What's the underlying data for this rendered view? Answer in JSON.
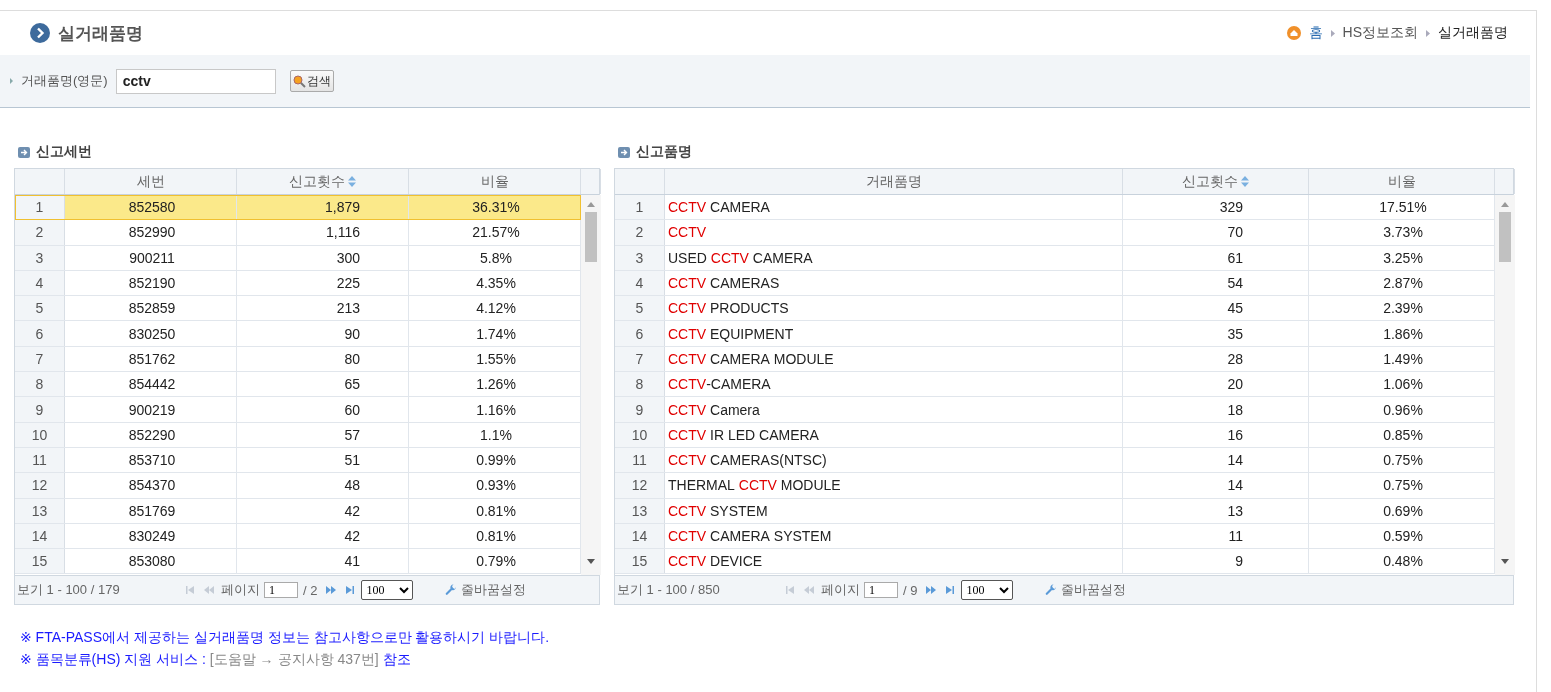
{
  "header": {
    "title": "실거래품명",
    "breadcrumb": [
      {
        "label": "홈",
        "kind": "home"
      },
      {
        "label": "HS정보조회",
        "kind": "link"
      },
      {
        "label": "실거래품명",
        "kind": "current"
      }
    ]
  },
  "search": {
    "label": "거래품명(영문)",
    "value": "cctv",
    "button": "검색"
  },
  "panels": [
    {
      "title": "신고세번",
      "columns": [
        {
          "label": "세번",
          "sortable": false
        },
        {
          "label": "신고횟수",
          "sortable": true
        },
        {
          "label": "비율",
          "sortable": false
        }
      ],
      "rows": [
        {
          "no": "1",
          "selected": true,
          "cells": [
            "852580",
            "1,879",
            "36.31%"
          ]
        },
        {
          "no": "2",
          "selected": false,
          "cells": [
            "852990",
            "1,116",
            "21.57%"
          ]
        },
        {
          "no": "3",
          "selected": false,
          "cells": [
            "900211",
            "300",
            "5.8%"
          ]
        },
        {
          "no": "4",
          "selected": false,
          "cells": [
            "852190",
            "225",
            "4.35%"
          ]
        },
        {
          "no": "5",
          "selected": false,
          "cells": [
            "852859",
            "213",
            "4.12%"
          ]
        },
        {
          "no": "6",
          "selected": false,
          "cells": [
            "830250",
            "90",
            "1.74%"
          ]
        },
        {
          "no": "7",
          "selected": false,
          "cells": [
            "851762",
            "80",
            "1.55%"
          ]
        },
        {
          "no": "8",
          "selected": false,
          "cells": [
            "854442",
            "65",
            "1.26%"
          ]
        },
        {
          "no": "9",
          "selected": false,
          "cells": [
            "900219",
            "60",
            "1.16%"
          ]
        },
        {
          "no": "10",
          "selected": false,
          "cells": [
            "852290",
            "57",
            "1.1%"
          ]
        },
        {
          "no": "11",
          "selected": false,
          "cells": [
            "853710",
            "51",
            "0.99%"
          ]
        },
        {
          "no": "12",
          "selected": false,
          "cells": [
            "854370",
            "48",
            "0.93%"
          ]
        },
        {
          "no": "13",
          "selected": false,
          "cells": [
            "851769",
            "42",
            "0.81%"
          ]
        },
        {
          "no": "14",
          "selected": false,
          "cells": [
            "830249",
            "42",
            "0.81%"
          ]
        },
        {
          "no": "15",
          "selected": false,
          "cells": [
            "853080",
            "41",
            "0.79%"
          ]
        }
      ],
      "footer": {
        "range": "보기 1 - 100 / 179",
        "page_label": "페이지",
        "page": "1",
        "page_total": "/ 2",
        "page_size": "100",
        "wrap": "줄바꿈설정"
      }
    },
    {
      "title": "신고품명",
      "columns": [
        {
          "label": "거래품명",
          "sortable": false
        },
        {
          "label": "신고횟수",
          "sortable": true
        },
        {
          "label": "비율",
          "sortable": false
        }
      ],
      "rows": [
        {
          "no": "1",
          "selected": false,
          "cells": [
            {
              "parts": [
                {
                  "text": "CCTV",
                  "match": true
                },
                {
                  "text": " CAMERA",
                  "match": false
                }
              ]
            },
            "329",
            "17.51%"
          ]
        },
        {
          "no": "2",
          "selected": false,
          "cells": [
            {
              "parts": [
                {
                  "text": "CCTV",
                  "match": true
                }
              ]
            },
            "70",
            "3.73%"
          ]
        },
        {
          "no": "3",
          "selected": false,
          "cells": [
            {
              "parts": [
                {
                  "text": "USED ",
                  "match": false
                },
                {
                  "text": "CCTV",
                  "match": true
                },
                {
                  "text": " CAMERA",
                  "match": false
                }
              ]
            },
            "61",
            "3.25%"
          ]
        },
        {
          "no": "4",
          "selected": false,
          "cells": [
            {
              "parts": [
                {
                  "text": "CCTV",
                  "match": true
                },
                {
                  "text": " CAMERAS",
                  "match": false
                }
              ]
            },
            "54",
            "2.87%"
          ]
        },
        {
          "no": "5",
          "selected": false,
          "cells": [
            {
              "parts": [
                {
                  "text": "CCTV",
                  "match": true
                },
                {
                  "text": " PRODUCTS",
                  "match": false
                }
              ]
            },
            "45",
            "2.39%"
          ]
        },
        {
          "no": "6",
          "selected": false,
          "cells": [
            {
              "parts": [
                {
                  "text": "CCTV",
                  "match": true
                },
                {
                  "text": " EQUIPMENT",
                  "match": false
                }
              ]
            },
            "35",
            "1.86%"
          ]
        },
        {
          "no": "7",
          "selected": false,
          "cells": [
            {
              "parts": [
                {
                  "text": "CCTV",
                  "match": true
                },
                {
                  "text": " CAMERA MODULE",
                  "match": false
                }
              ]
            },
            "28",
            "1.49%"
          ]
        },
        {
          "no": "8",
          "selected": false,
          "cells": [
            {
              "parts": [
                {
                  "text": "CCTV",
                  "match": true
                },
                {
                  "text": "-CAMERA",
                  "match": false
                }
              ]
            },
            "20",
            "1.06%"
          ]
        },
        {
          "no": "9",
          "selected": false,
          "cells": [
            {
              "parts": [
                {
                  "text": "CCTV",
                  "match": true
                },
                {
                  "text": " Camera",
                  "match": false
                }
              ]
            },
            "18",
            "0.96%"
          ]
        },
        {
          "no": "10",
          "selected": false,
          "cells": [
            {
              "parts": [
                {
                  "text": "CCTV",
                  "match": true
                },
                {
                  "text": " IR LED CAMERA",
                  "match": false
                }
              ]
            },
            "16",
            "0.85%"
          ]
        },
        {
          "no": "11",
          "selected": false,
          "cells": [
            {
              "parts": [
                {
                  "text": "CCTV",
                  "match": true
                },
                {
                  "text": " CAMERAS(NTSC)",
                  "match": false
                }
              ]
            },
            "14",
            "0.75%"
          ]
        },
        {
          "no": "12",
          "selected": false,
          "cells": [
            {
              "parts": [
                {
                  "text": "THERMAL ",
                  "match": false
                },
                {
                  "text": "CCTV",
                  "match": true
                },
                {
                  "text": " MODULE",
                  "match": false
                }
              ]
            },
            "14",
            "0.75%"
          ]
        },
        {
          "no": "13",
          "selected": false,
          "cells": [
            {
              "parts": [
                {
                  "text": "CCTV",
                  "match": true
                },
                {
                  "text": " SYSTEM",
                  "match": false
                }
              ]
            },
            "13",
            "0.69%"
          ]
        },
        {
          "no": "14",
          "selected": false,
          "cells": [
            {
              "parts": [
                {
                  "text": "CCTV",
                  "match": true
                },
                {
                  "text": " CAMERA SYSTEM",
                  "match": false
                }
              ]
            },
            "11",
            "0.59%"
          ]
        },
        {
          "no": "15",
          "selected": false,
          "cells": [
            {
              "parts": [
                {
                  "text": "CCTV",
                  "match": true
                },
                {
                  "text": " DEVICE",
                  "match": false
                }
              ]
            },
            "9",
            "0.48%"
          ]
        }
      ],
      "footer": {
        "range": "보기 1 - 100 / 850",
        "page_label": "페이지",
        "page": "1",
        "page_total": "/ 9",
        "page_size": "100",
        "wrap": "줄바꿈설정"
      }
    }
  ],
  "notes": [
    {
      "parts": [
        {
          "text": "※ FTA-PASS에서 제공하는 실거래품명 정보는 참고사항으로만 활용하시기 바랍니다.",
          "kind": "text"
        }
      ]
    },
    {
      "parts": [
        {
          "text": "※ 품목분류(HS) 지원 서비스 : ",
          "kind": "text"
        },
        {
          "text": "[도움말 → 공지사항 437번]",
          "kind": "link"
        },
        {
          "text": " 참조",
          "kind": "text"
        }
      ]
    }
  ]
}
